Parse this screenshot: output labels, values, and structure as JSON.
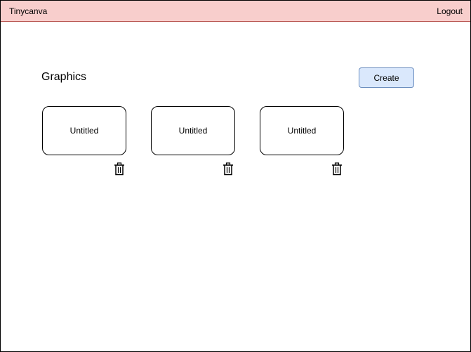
{
  "header": {
    "app_name": "Tinycanva",
    "logout_label": "Logout",
    "background_color": "#f8cecc",
    "border_color": "#b85450"
  },
  "main": {
    "section_title": "Graphics",
    "create_label": "Create",
    "create_color": "#dae8fc",
    "graphics": [
      {
        "title": "Untitled",
        "delete_icon": "trash-icon"
      },
      {
        "title": "Untitled",
        "delete_icon": "trash-icon"
      },
      {
        "title": "Untitled",
        "delete_icon": "trash-icon"
      }
    ]
  }
}
